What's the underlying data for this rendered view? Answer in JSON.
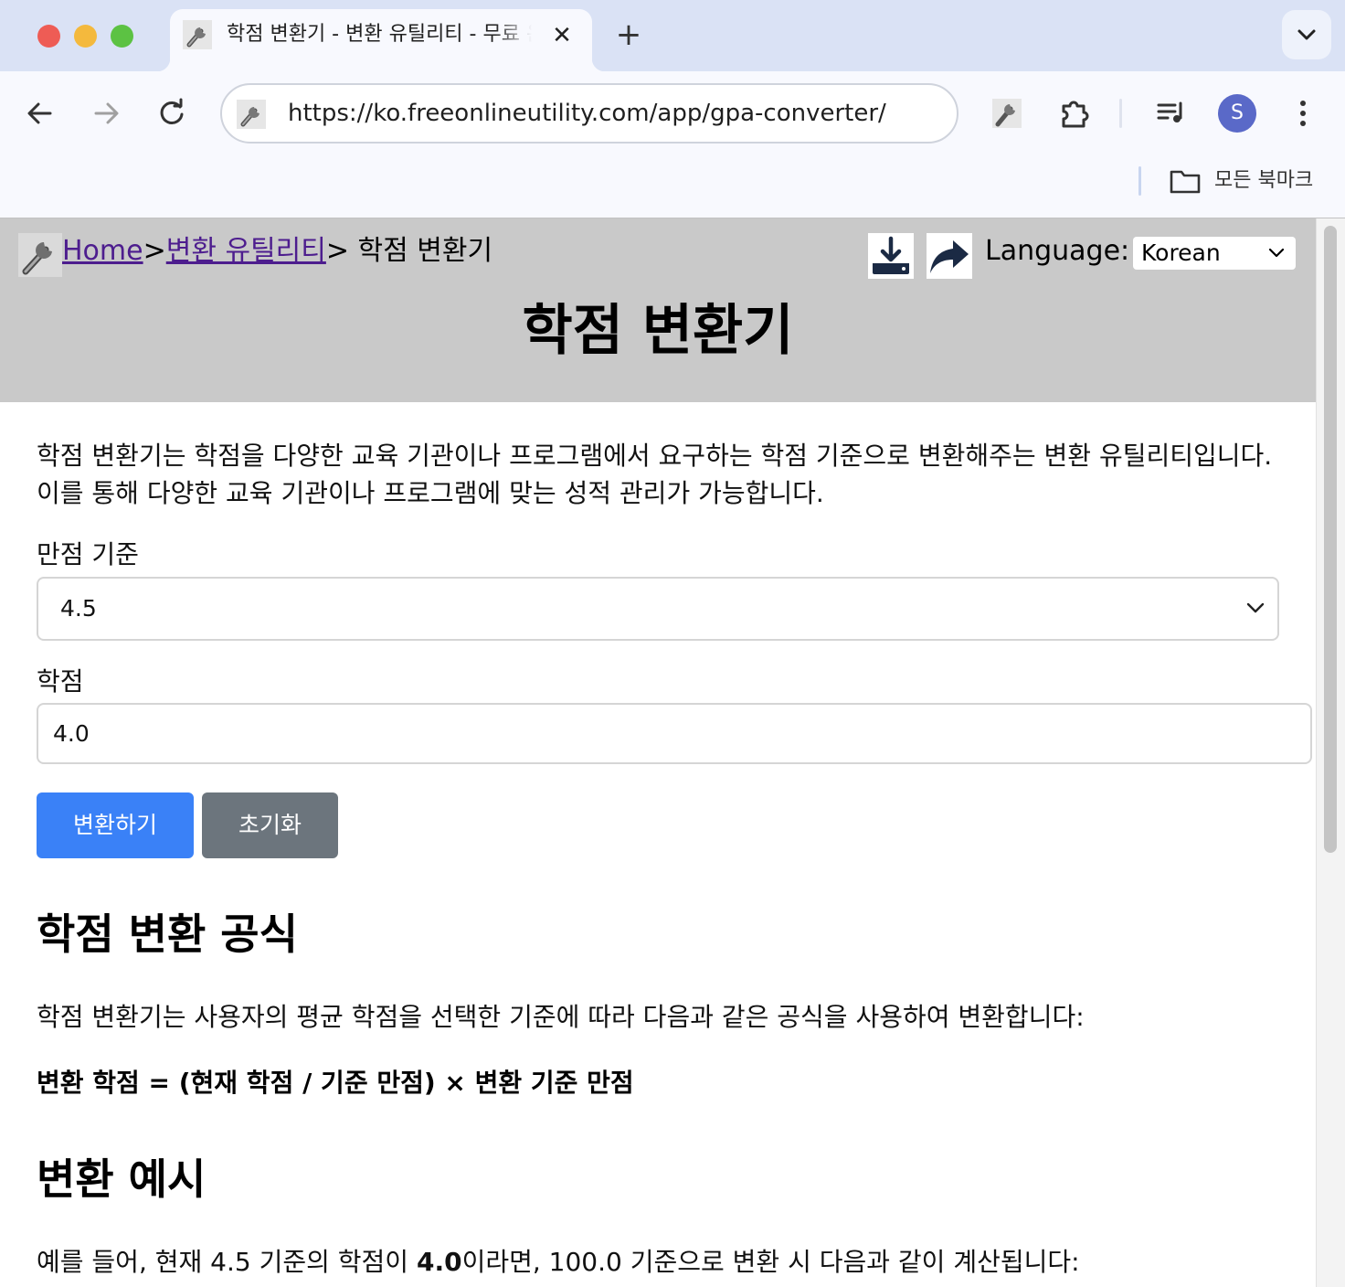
{
  "browser": {
    "tab_title": "학점 변환기 - 변환 유틸리티 - 무료 온라인 유틸리티",
    "tab_close": "✕",
    "new_tab": "+",
    "url": "https://ko.freeonlineutility.com/app/gpa-converter/",
    "profile_initial": "S",
    "bookmarks_label": "모든 북마크"
  },
  "header": {
    "breadcrumb_home": "Home",
    "breadcrumb_sep1": ">",
    "breadcrumb_category": "변환 유틸리티",
    "breadcrumb_current": "> 학점 변환기",
    "language_label": "Language:",
    "language_value": "Korean",
    "title": "학점 변환기"
  },
  "main": {
    "intro": "학점 변환기는 학점을 다양한 교육 기관이나 프로그램에서 요구하는 학점 기준으로 변환해주는 변환 유틸리티입니다. 이를 통해 다양한 교육 기관이나 프로그램에 맞는 성적 관리가 가능합니다.",
    "scale_label": "만점 기준",
    "scale_value": "4.5",
    "grade_label": "학점",
    "grade_value": "4.0",
    "convert_button": "변환하기",
    "reset_button": "초기화",
    "formula_heading": "학점 변환 공식",
    "formula_desc": "학점 변환기는 사용자의 평균 학점을 선택한 기준에 따라 다음과 같은 공식을 사용하여 변환합니다:",
    "formula": "변환 학점 = (현재 학점 / 기준 만점) × 변환 기준 만점",
    "example_heading": "변환 예시",
    "example_prefix": "예를 들어, 현재 4.5 기준의 학점이 ",
    "example_bold": "4.0",
    "example_suffix": "이라면, 100.0 기준으로 변환 시 다음과 같이 계산됩니다:"
  },
  "colors": {
    "primary_button": "#3a81f7",
    "secondary_button": "#6c757d",
    "header_bg": "#c9c9c9",
    "link_visited": "#4d1d8e",
    "avatar": "#5a69c8"
  },
  "icons": {
    "favicon": "wrench-icon",
    "download": "download-icon",
    "share": "share-icon",
    "back": "arrow-left-icon",
    "forward": "arrow-right-icon",
    "reload": "reload-icon",
    "extensions": "puzzle-icon",
    "media": "media-control-icon",
    "menu": "kebab-menu-icon",
    "folder": "folder-icon",
    "tab_search": "chevron-down-icon"
  }
}
